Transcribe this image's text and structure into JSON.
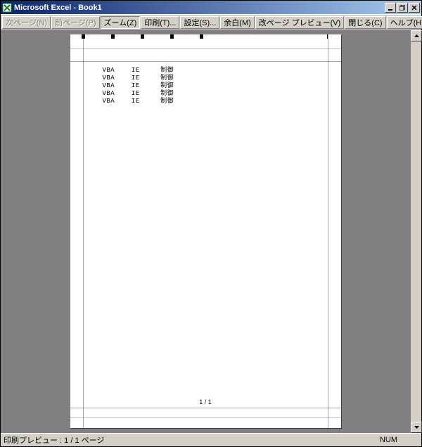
{
  "titlebar": {
    "app_name": "Microsoft Excel",
    "doc_name": "Book1",
    "full_title": "Microsoft Excel - Book1"
  },
  "toolbar": {
    "next": "次ページ(N)",
    "prev": "前ページ(P)",
    "zoom": "ズーム(Z)",
    "print": "印刷(T)...",
    "setup": "設定(S)...",
    "margins": "余白(M)",
    "pagebreak": "改ページ プレビュー(V)",
    "close": "閉じる(C)",
    "help": "ヘルプ(H)"
  },
  "preview": {
    "footer_page": "1 / 1",
    "rows": [
      {
        "c1": "VBA",
        "c2": "IE",
        "c3": "制御"
      },
      {
        "c1": "VBA",
        "c2": "IE",
        "c3": "制御"
      },
      {
        "c1": "VBA",
        "c2": "IE",
        "c3": "制御"
      },
      {
        "c1": "VBA",
        "c2": "IE",
        "c3": "制御"
      },
      {
        "c1": "VBA",
        "c2": "IE",
        "c3": "制御"
      }
    ]
  },
  "statusbar": {
    "left": "印刷プレビュー : 1 / 1 ページ",
    "num": "NUM"
  }
}
